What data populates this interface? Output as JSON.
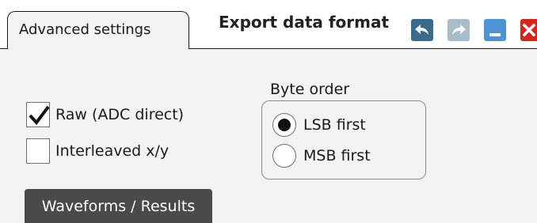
{
  "tab": {
    "label": "Advanced settings"
  },
  "title": "Export data format",
  "toolbar": {
    "undo_icon": "undo-icon",
    "redo_icon": "redo-icon",
    "minimize_icon": "minimize-icon",
    "close_icon": "close-icon"
  },
  "options": {
    "raw": {
      "label": "Raw (ADC direct)",
      "checked": true
    },
    "interleaved": {
      "label": "Interleaved x/y",
      "checked": false
    }
  },
  "byte_order": {
    "title": "Byte order",
    "options": [
      {
        "label": "LSB first",
        "selected": true
      },
      {
        "label": "MSB first",
        "selected": false
      }
    ]
  },
  "footer": {
    "button_label": "Waveforms / Results"
  },
  "colors": {
    "undo": "#3a6a8c",
    "redo_disabled": "#a9bccb",
    "minimize": "#4d93d6",
    "close": "#d9231d",
    "footer_button": "#4a4a4a"
  }
}
